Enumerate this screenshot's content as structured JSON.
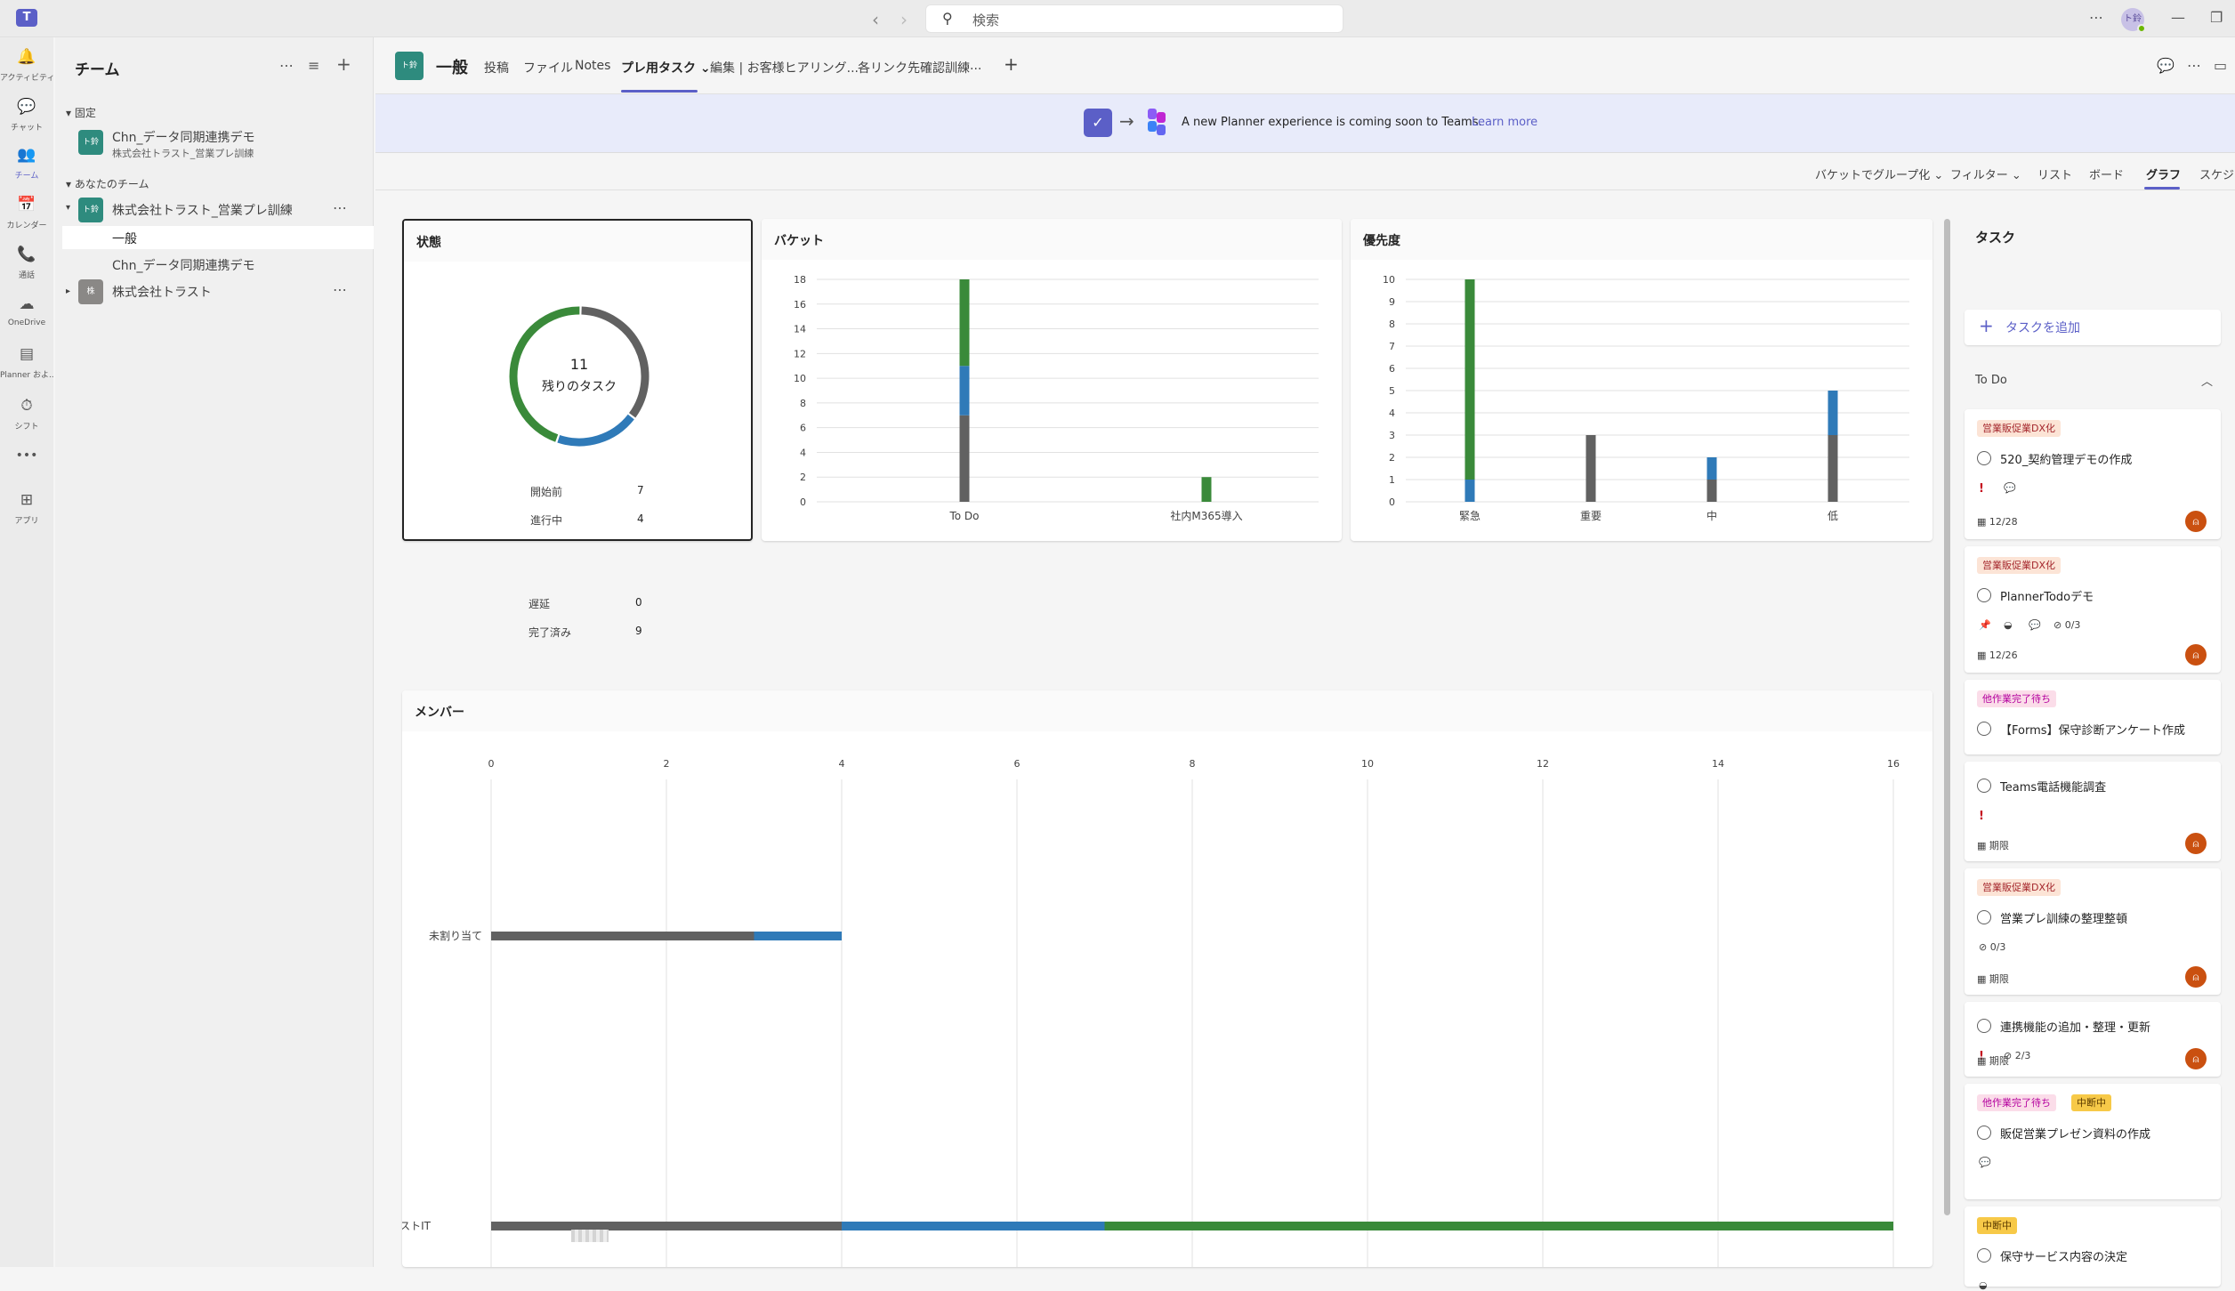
{
  "topbar": {
    "search_placeholder": "検索",
    "avatar": "ト鈴"
  },
  "rail": [
    {
      "icon": "bell-icon",
      "label": "アクティビティ",
      "glyph": "🔔"
    },
    {
      "icon": "chat-icon",
      "label": "チャット",
      "glyph": "💬"
    },
    {
      "icon": "teams-icon",
      "label": "チーム",
      "glyph": "👥"
    },
    {
      "icon": "calendar-icon",
      "label": "カレンダー",
      "glyph": "📅"
    },
    {
      "icon": "phone-icon",
      "label": "通話",
      "glyph": "📞"
    },
    {
      "icon": "onedrive-icon",
      "label": "OneDrive",
      "glyph": "☁"
    },
    {
      "icon": "planner-icon",
      "label": "Planner およ...",
      "glyph": "▤"
    },
    {
      "icon": "shift-icon",
      "label": "シフト",
      "glyph": "⏱"
    },
    {
      "icon": "more-icon",
      "label": "",
      "glyph": "•••"
    },
    {
      "icon": "apps-icon",
      "label": "アプリ",
      "glyph": "⊞"
    }
  ],
  "sidebar": {
    "title": "チーム",
    "pinned_header": "固定",
    "pinned": {
      "avatar": "ト鈴",
      "name": "Chn_データ同期連携デモ",
      "sub": "株式会社トラスト_営業プレ訓練"
    },
    "your_teams_header": "あなたのチーム",
    "teams": [
      {
        "avatar": "ト鈴",
        "name": "株式会社トラスト_営業プレ訓練",
        "channels": [
          "一般",
          "Chn_データ同期連携デモ"
        ]
      },
      {
        "avatar": "株",
        "name": "株式会社トラスト",
        "channels": []
      }
    ]
  },
  "header": {
    "team_avatar": "ト鈴",
    "channel": "一般",
    "tabs": [
      "投稿",
      "ファイル",
      "Notes",
      "プレ用タスク",
      "編集 | お客様ヒアリング...",
      "各リンク先確認訓練",
      "..."
    ],
    "active_tab": "プレ用タスク"
  },
  "banner": {
    "message": "A new Planner experience is coming soon to Teams.",
    "link": "Learn more"
  },
  "toolbar": {
    "group_by": "バケットでグループ化",
    "filter": "フィルター",
    "views": [
      "リスト",
      "ボード",
      "グラフ",
      "スケジュール"
    ],
    "active_view": "グラフ"
  },
  "colors": {
    "not_started": "#616161",
    "in_progress": "#2f7ab8",
    "late": "#c50f1f",
    "done": "#3a8a3a",
    "accent": "#5b5fc7"
  },
  "status_card": {
    "title": "状態",
    "remaining_count": "11",
    "remaining_label": "残りのタスク",
    "rows": [
      {
        "label": "開始前",
        "value": 7
      },
      {
        "label": "進行中",
        "value": 4
      },
      {
        "label": "遅延",
        "value": 0
      },
      {
        "label": "完了済み",
        "value": 9
      }
    ]
  },
  "chart_data": [
    {
      "type": "bar",
      "title": "バケット",
      "categories": [
        "To Do",
        "社内M365導入"
      ],
      "series": [
        {
          "values": [
            7,
            0
          ]
        },
        {
          "values": [
            4,
            0
          ]
        },
        {
          "values": [
            7,
            2
          ]
        }
      ],
      "ylim": [
        0,
        18
      ],
      "yticks": [
        0,
        2,
        4,
        6,
        8,
        10,
        12,
        14,
        16,
        18
      ],
      "grid": true
    },
    {
      "type": "bar",
      "title": "優先度",
      "categories": [
        "緊急",
        "重要",
        "中",
        "低"
      ],
      "series": [
        {
          "values": [
            0,
            3,
            1,
            3
          ]
        },
        {
          "values": [
            1,
            0,
            1,
            2
          ]
        },
        {
          "values": [
            9,
            0,
            0,
            0
          ]
        }
      ],
      "ylim": [
        0,
        10
      ],
      "yticks": [
        0,
        1,
        2,
        3,
        4,
        5,
        6,
        7,
        8,
        9,
        10
      ],
      "grid": true
    },
    {
      "type": "bar",
      "orientation": "horizontal",
      "title": "メンバー",
      "categories": [
        "未割り当て",
        "トラストIT"
      ],
      "series": [
        {
          "values": [
            3,
            4
          ]
        },
        {
          "values": [
            1,
            3
          ]
        },
        {
          "values": [
            0,
            9
          ]
        }
      ],
      "xlim": [
        0,
        16
      ],
      "xticks": [
        0,
        2,
        4,
        6,
        8,
        10,
        12,
        14,
        16
      ],
      "grid": true
    }
  ],
  "tasks": {
    "title": "タスク",
    "add_label": "タスクを追加",
    "group": "To Do",
    "items": [
      {
        "labels": [
          {
            "text": "営業販促業DX化",
            "kind": "orange"
          }
        ],
        "name": "520_契約管理デモの作成",
        "meta": [
          "!",
          "💬"
        ],
        "due": "12/28",
        "assignee": true
      },
      {
        "labels": [
          {
            "text": "営業販促業DX化",
            "kind": "orange"
          }
        ],
        "name": "PlannerTodoデモ",
        "meta": [
          "📌",
          "◒",
          "💬",
          "⊘ 0/3"
        ],
        "due": "12/26",
        "assignee": true
      },
      {
        "labels": [
          {
            "text": "他作業完了待ち",
            "kind": "pink"
          }
        ],
        "name": "【Forms】保守診断アンケート作成",
        "meta": [],
        "due": "",
        "assignee": false
      },
      {
        "labels": [],
        "name": "Teams電話機能調査",
        "meta": [
          "!"
        ],
        "due": "期限",
        "assignee": true
      },
      {
        "labels": [
          {
            "text": "営業販促業DX化",
            "kind": "orange"
          }
        ],
        "name": "営業プレ訓練の整理整頓",
        "meta": [
          "⊘ 0/3"
        ],
        "due": "期限",
        "assignee": true
      },
      {
        "labels": [],
        "name": "連携機能の追加・整理・更新",
        "meta": [
          "!",
          "⊘ 2/3"
        ],
        "due": "期限",
        "assignee": true
      },
      {
        "labels": [
          {
            "text": "他作業完了待ち",
            "kind": "pink"
          },
          {
            "text": "中断中",
            "kind": "yellow"
          }
        ],
        "name": "販促営業プレゼン資料の作成",
        "meta": [
          "💬"
        ],
        "due": "",
        "assignee": false
      },
      {
        "labels": [
          {
            "text": "中断中",
            "kind": "yellow"
          }
        ],
        "name": "保守サービス内容の決定",
        "meta": [
          "◒"
        ],
        "due": "",
        "assignee": false
      }
    ]
  }
}
